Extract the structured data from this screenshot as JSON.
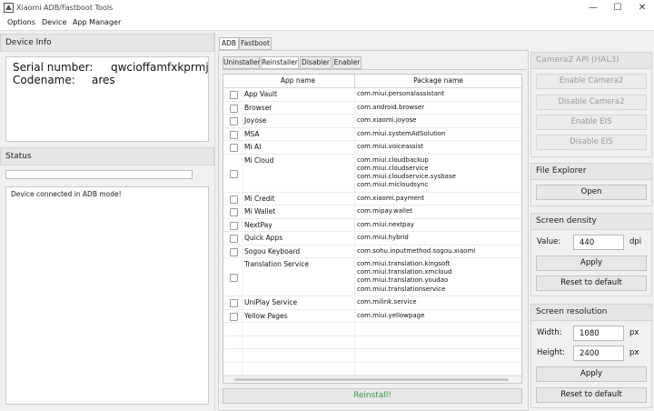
{
  "window": {
    "title": "Xiaomi ADB/Fastboot Tools",
    "controls": {
      "minimize": "—",
      "maximize": "☐",
      "close": "✕"
    }
  },
  "menu": [
    "Options",
    "Device",
    "App Manager"
  ],
  "device_info": {
    "header": "Device Info",
    "serial_label": "Serial number:",
    "serial_value": "qwcioffamfxkprmj",
    "codename_label": "Codename:",
    "codename_value": "ares"
  },
  "status": {
    "header": "Status",
    "log": "Device connected in ADB mode!"
  },
  "tabs": {
    "main": [
      "ADB",
      "Fastboot"
    ],
    "main_active": "ADB",
    "sub": [
      "Uninstaller",
      "Reinstaller",
      "Disabler",
      "Enabler"
    ],
    "sub_active": "Reinstaller"
  },
  "table": {
    "col_app": "App name",
    "col_pkg": "Package name",
    "rows": [
      {
        "app": "App Vault",
        "pkg": [
          "com.miui.personalassistant"
        ]
      },
      {
        "app": "Browser",
        "pkg": [
          "com.android.browser"
        ]
      },
      {
        "app": "Joyose",
        "pkg": [
          "com.xiaomi.joyose"
        ]
      },
      {
        "app": "MSA",
        "pkg": [
          "com.miui.systemAdSolution"
        ]
      },
      {
        "app": "Mi AI",
        "pkg": [
          "com.miui.voiceassist"
        ]
      },
      {
        "app": "Mi Cloud",
        "pkg": [
          "com.miui.cloudbackup",
          "com.miui.cloudservice",
          "com.miui.cloudservice.sysbase",
          "com.miui.micloudsync"
        ]
      },
      {
        "app": "Mi Credit",
        "pkg": [
          "com.xiaomi.payment"
        ]
      },
      {
        "app": "Mi Wallet",
        "pkg": [
          "com.mipay.wallet"
        ]
      },
      {
        "app": "NextPay",
        "pkg": [
          "com.miui.nextpay"
        ]
      },
      {
        "app": "Quick Apps",
        "pkg": [
          "com.miui.hybrid"
        ]
      },
      {
        "app": "Sogou Keyboard",
        "pkg": [
          "com.sohu.inputmethod.sogou.xiaomi"
        ]
      },
      {
        "app": "Translation Service",
        "pkg": [
          "com.miui.translation.kingsoft",
          "com.miui.translation.xmcloud",
          "com.miui.translation.youdao",
          "com.miui.translationservice"
        ]
      },
      {
        "app": "UniPlay Service",
        "pkg": [
          "com.milink.service"
        ]
      },
      {
        "app": "Yellow Pages",
        "pkg": [
          "com.miui.yellowpage"
        ]
      }
    ]
  },
  "reinstall_button": "Reinstall!",
  "camera": {
    "header": "Camera2 API (HAL3)",
    "enable_camera2": "Enable Camera2",
    "disable_camera2": "Disable Camera2",
    "enable_eis": "Enable EIS",
    "disable_eis": "Disable EIS"
  },
  "file_explorer": {
    "header": "File Explorer",
    "open": "Open"
  },
  "density": {
    "header": "Screen density",
    "value_label": "Value:",
    "value": "440",
    "unit": "dpi",
    "apply": "Apply",
    "reset": "Reset to default"
  },
  "resolution": {
    "header": "Screen resolution",
    "width_label": "Width:",
    "width": "1080",
    "height_label": "Height:",
    "height": "2400",
    "unit": "px",
    "apply": "Apply",
    "reset": "Reset to default"
  },
  "colors": {
    "reinstall_text": "#2e9d3f",
    "disabled_text": "#9a9a9a"
  }
}
